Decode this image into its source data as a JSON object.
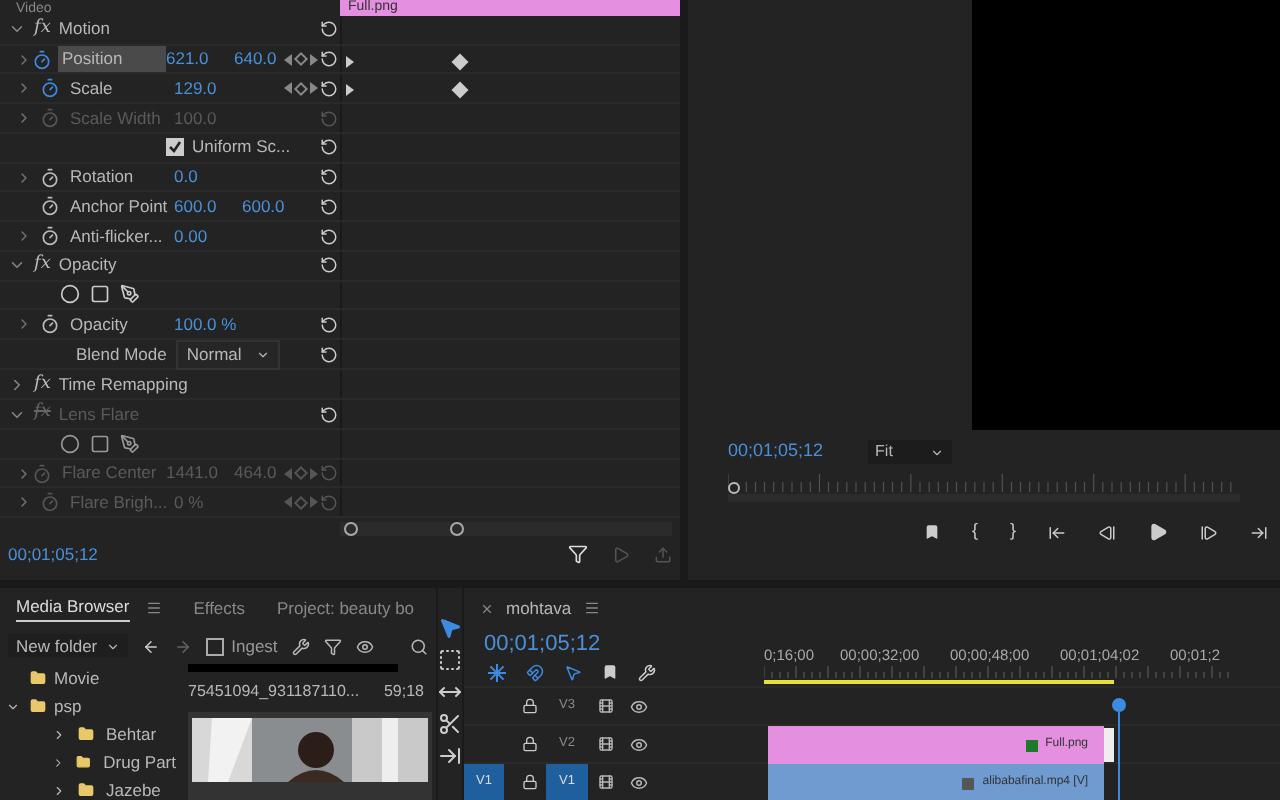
{
  "effect_controls": {
    "section": "Video",
    "clip": "Full.png",
    "rows": [
      {
        "kind": "effect",
        "fx": "fx",
        "name": "Motion",
        "expanded": true,
        "enabled": true
      },
      {
        "kind": "property",
        "name": "Position",
        "values": [
          "621.0",
          "640.0"
        ],
        "animated": true,
        "disabled": false,
        "expandable": true,
        "selected": true,
        "nav": true,
        "keyframes": true
      },
      {
        "kind": "property",
        "name": "Scale",
        "values": [
          "129.0"
        ],
        "animated": true,
        "disabled": false,
        "expandable": true,
        "selected": false,
        "nav": true,
        "keyframes": true
      },
      {
        "kind": "property",
        "name": "Scale Width",
        "values": [
          "100.0"
        ],
        "animated": false,
        "disabled": true,
        "expandable": true,
        "selected": false,
        "nav": false,
        "keyframes": false
      },
      {
        "kind": "checkbox",
        "name": "Uniform Sc...",
        "checked": true
      },
      {
        "kind": "property",
        "name": "Rotation",
        "values": [
          "0.0"
        ],
        "animated": false,
        "disabled": false,
        "expandable": true,
        "selected": false,
        "nav": false,
        "keyframes": false
      },
      {
        "kind": "property",
        "name": "Anchor Point",
        "values": [
          "600.0",
          "600.0"
        ],
        "animated": false,
        "disabled": false,
        "expandable": false,
        "selected": false,
        "nav": false,
        "keyframes": false
      },
      {
        "kind": "property",
        "name": "Anti-flicker...",
        "values": [
          "0.00"
        ],
        "animated": false,
        "disabled": false,
        "expandable": true,
        "selected": false,
        "nav": false,
        "keyframes": false
      },
      {
        "kind": "effect",
        "fx": "fx",
        "name": "Opacity",
        "expanded": true,
        "enabled": true
      },
      {
        "kind": "masks",
        "disabled": false
      },
      {
        "kind": "property",
        "name": "Opacity",
        "values": [
          "100.0 %"
        ],
        "animated": false,
        "disabled": false,
        "expandable": true,
        "selected": false,
        "nav": false,
        "keyframes": false
      },
      {
        "kind": "dropdown",
        "name": "Blend Mode",
        "value": "Normal"
      },
      {
        "kind": "effect",
        "fx": "fx",
        "name": "Time Remapping",
        "expanded": false,
        "enabled": true
      },
      {
        "kind": "effect",
        "fx": "fx",
        "name": "Lens Flare",
        "expanded": true,
        "enabled": false
      },
      {
        "kind": "masks",
        "disabled": true
      },
      {
        "kind": "property",
        "name": "Flare Center",
        "values": [
          "1441.0",
          "464.0"
        ],
        "animated": false,
        "disabled": true,
        "expandable": true,
        "selected": false,
        "nav": true,
        "keyframes": false
      },
      {
        "kind": "property",
        "name": "Flare Brigh...",
        "values": [
          "0 %"
        ],
        "animated": false,
        "disabled": true,
        "expandable": true,
        "selected": false,
        "nav": true,
        "keyframes": false
      }
    ],
    "timecode": "00;01;05;12"
  },
  "program_monitor": {
    "timecode": "00;01;05;12",
    "zoom": "Fit",
    "mark_in": "{",
    "mark_out": "}"
  },
  "media_browser": {
    "tabs": [
      {
        "label": "Media Browser",
        "selected": true
      },
      {
        "label": "Effects",
        "selected": false
      },
      {
        "label": "Project: beauty bo",
        "selected": false
      }
    ],
    "folder_menu": "New folder",
    "ingest": {
      "label": "Ingest",
      "checked": false
    },
    "folders": [
      {
        "name": "Movie"
      },
      {
        "name": "psp",
        "expanded": true,
        "children": [
          {
            "name": "Behtar"
          },
          {
            "name": "Drug Part"
          },
          {
            "name": "Jazebe"
          }
        ]
      }
    ],
    "clip": {
      "name": "75451094_931187110...",
      "duration": "59;18",
      "kind": "picture"
    }
  },
  "tools": [
    {
      "kind": "selection",
      "selected": true
    },
    {
      "kind": "track-select",
      "selected": false
    },
    {
      "kind": "ripple",
      "selected": false
    },
    {
      "kind": "razor",
      "selected": false
    },
    {
      "kind": "slip",
      "selected": false
    }
  ],
  "timeline": {
    "sequence": "mohtava",
    "timecode": "00;01;05;12",
    "ruler": [
      "0;16;00",
      "00;00;32;00",
      "00;00;48;00",
      "00;01;04;02",
      "00;01;2"
    ],
    "tracks": [
      {
        "name": "V3",
        "targeted": false
      },
      {
        "name": "V2",
        "targeted": false,
        "clip": {
          "name": "Full.png",
          "color": "#e58fe0"
        }
      },
      {
        "name": "V1",
        "source": "V1",
        "targeted": true,
        "clip": {
          "name": "alibabafinal.mp4 [V]",
          "color": "#6f9bd1"
        }
      }
    ]
  }
}
